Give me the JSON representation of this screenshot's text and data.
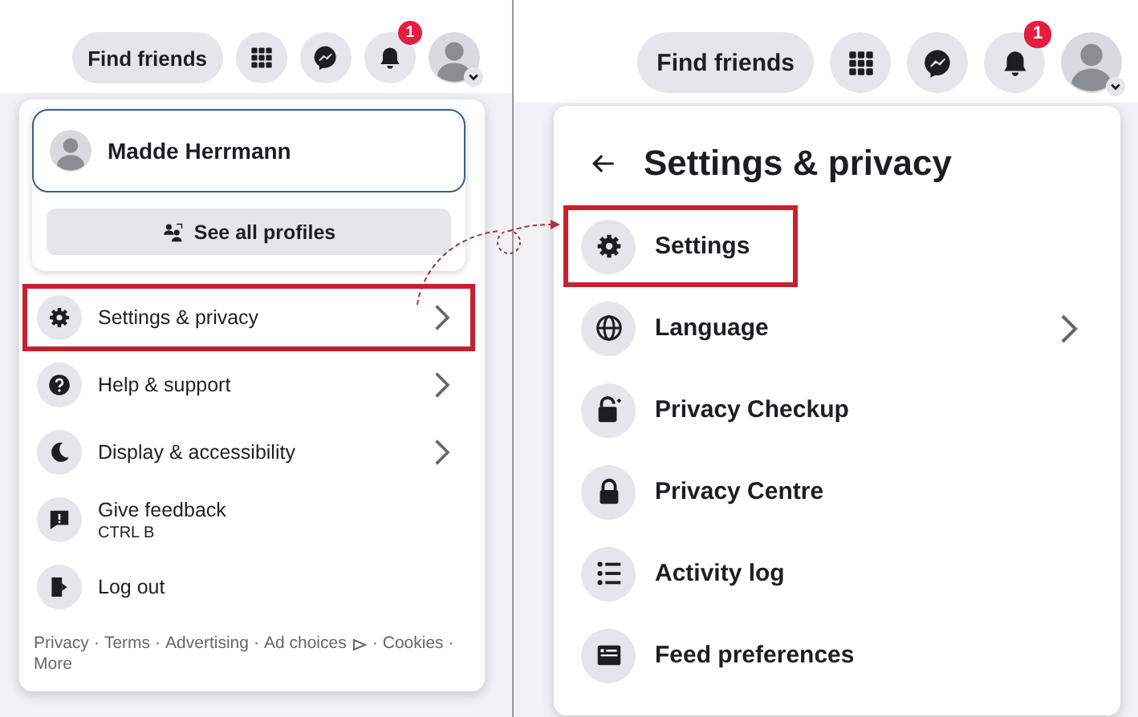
{
  "main_menu": {
    "top_bar": {
      "find_friends": "Find friends",
      "notification_count": "1"
    },
    "profile": {
      "name": "Madde Herrmann",
      "see_all": "See all profiles"
    },
    "items": [
      {
        "label": "Settings & privacy",
        "has_submenu": true,
        "highlighted": true
      },
      {
        "label": "Help & support",
        "has_submenu": true,
        "highlighted": false
      },
      {
        "label": "Display & accessibility",
        "has_submenu": true,
        "highlighted": false
      },
      {
        "label": "Give feedback",
        "shortcut": "CTRL B",
        "has_submenu": false,
        "highlighted": false
      },
      {
        "label": "Log out",
        "has_submenu": false,
        "highlighted": false
      }
    ],
    "footer_links": [
      {
        "text": "Privacy",
        "separator": "·"
      },
      {
        "text": "Terms",
        "separator": "·"
      },
      {
        "text": "Advertising",
        "separator": "·"
      },
      {
        "text": "Ad choices",
        "adchoices_icon": true,
        "separator": "·"
      },
      {
        "text": "Cookies",
        "separator": "·"
      },
      {
        "text": "More"
      }
    ]
  },
  "settings_menu": {
    "top_bar": {
      "find_friends": "Find friends",
      "notification_count": "1"
    },
    "title": "Settings & privacy",
    "items": [
      {
        "label": "Settings",
        "has_submenu": false,
        "highlighted": true
      },
      {
        "label": "Language",
        "has_submenu": true,
        "highlighted": false
      },
      {
        "label": "Privacy Checkup",
        "has_submenu": false,
        "highlighted": false
      },
      {
        "label": "Privacy Centre",
        "has_submenu": false,
        "highlighted": false
      },
      {
        "label": "Activity log",
        "has_submenu": false,
        "highlighted": false
      },
      {
        "label": "Feed preferences",
        "has_submenu": false,
        "highlighted": false
      }
    ]
  }
}
